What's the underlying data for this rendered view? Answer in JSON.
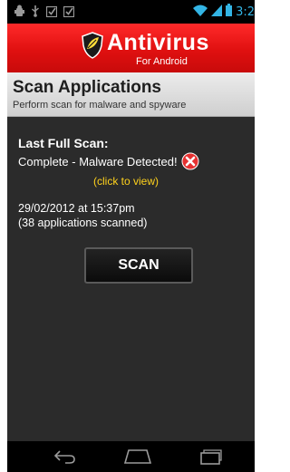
{
  "status_bar": {
    "time": "3:2",
    "icons": [
      "usb-debug-icon",
      "usb-icon",
      "download-done-icon",
      "download-done-icon",
      "wifi-icon",
      "signal-icon",
      "battery-icon"
    ]
  },
  "header": {
    "title": "Antivirus",
    "subtitle": "For Android",
    "icon": "shield-icon",
    "colors": {
      "background": "#e51919",
      "text": "#ffffff"
    }
  },
  "section": {
    "title": "Scan Applications",
    "subtitle": "Perform scan for malware and spyware"
  },
  "scan_info": {
    "label": "Last Full Scan:",
    "status": "Complete - Malware Detected!",
    "status_icon": "error-x-icon",
    "link": "(click to view)",
    "link_color": "#ffd21c",
    "date": "29/02/2012 at 15:37pm",
    "count": "(38 applications scanned)"
  },
  "scan_button": {
    "label": "SCAN"
  },
  "nav_bar": {
    "buttons": [
      "back-icon",
      "home-icon",
      "recent-apps-icon"
    ]
  }
}
